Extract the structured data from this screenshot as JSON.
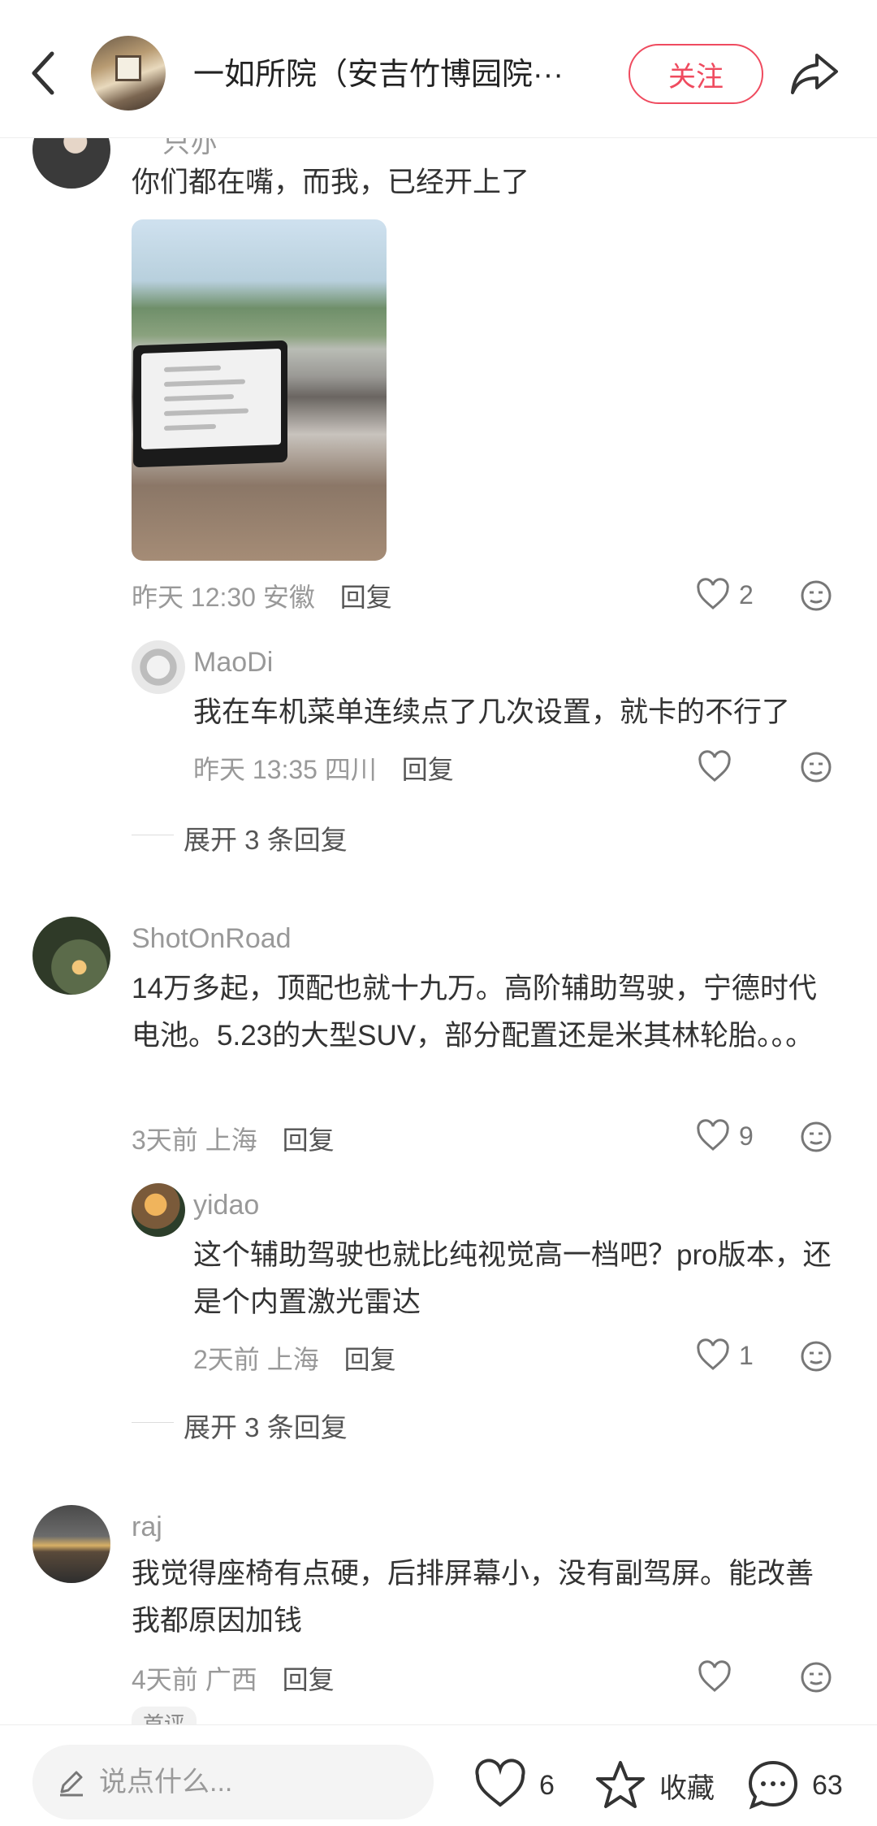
{
  "header": {
    "title": "一如所院（安吉竹博园院···",
    "follow_label": "关注"
  },
  "comments": [
    {
      "username": "只亦",
      "text": "你们都在嘴，而我，已经开上了",
      "time": "昨天 12:30",
      "location": "安徽",
      "reply_label": "回复",
      "likes": "2",
      "replies": [
        {
          "username": "MaoDi",
          "text": "我在车机菜单连续点了几次设置，就卡的不行了",
          "time": "昨天 13:35",
          "location": "四川",
          "reply_label": "回复",
          "likes": ""
        }
      ],
      "expand_label": "展开 3 条回复"
    },
    {
      "username": "ShotOnRoad",
      "text": "14万多起，顶配也就十九万。高阶辅助驾驶，宁德时代电池。5.23的大型SUV，部分配置还是米其林轮胎。。。",
      "time": "3天前",
      "location": "上海",
      "reply_label": "回复",
      "likes": "9",
      "replies": [
        {
          "username": "yidao",
          "text": "这个辅助驾驶也就比纯视觉高一档吧？pro版本，还是个内置激光雷达",
          "time": "2天前",
          "location": "上海",
          "reply_label": "回复",
          "likes": "1"
        }
      ],
      "expand_label": "展开 3 条回复"
    },
    {
      "username": "raj",
      "text": "我觉得座椅有点硬，后排屏幕小，没有副驾屏。能改善我都原因加钱",
      "time": "4天前",
      "location": "广西",
      "reply_label": "回复",
      "likes": "",
      "tag": "首评"
    }
  ],
  "bottom_bar": {
    "input_placeholder": "说点什么...",
    "like_count": "6",
    "collect_label": "收藏",
    "comment_count": "63"
  }
}
